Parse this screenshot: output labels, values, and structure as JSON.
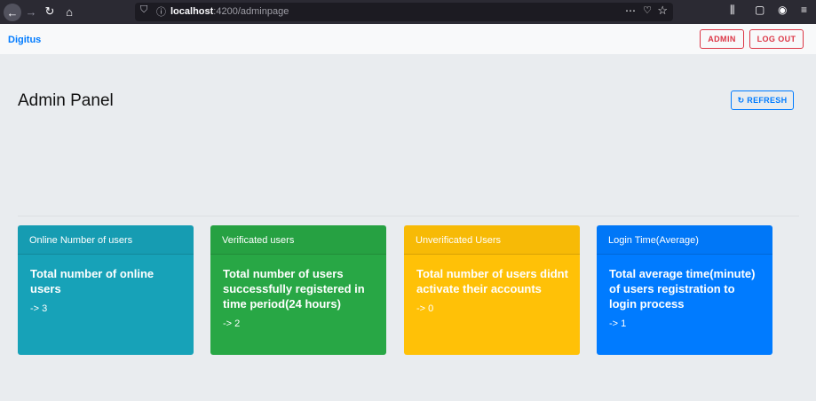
{
  "browser": {
    "url_host": "localhost",
    "url_path": ":4200/adminpage"
  },
  "navbar": {
    "brand": "Digitus",
    "admin_label": "ADMIN",
    "logout_label": "LOG OUT"
  },
  "panel": {
    "title": "Admin Panel",
    "refresh_label": "↻ REFRESH"
  },
  "cards": [
    {
      "header": "Online Number of users",
      "title": "Total number of online users",
      "value": "-> 3",
      "color": "#17a2b8"
    },
    {
      "header": "Verificated users",
      "title": "Total number of users successfully registered in time period(24 hours)",
      "value": "-> 2",
      "color": "#28a745"
    },
    {
      "header": "Unverificated Users",
      "title": "Total number of users didnt activate their accounts",
      "value": "-> 0",
      "color": "#ffc107"
    },
    {
      "header": "Login Time(Average)",
      "title": "Total average time(minute) of users registration to login process",
      "value": "-> 1",
      "color": "#007bff"
    }
  ]
}
